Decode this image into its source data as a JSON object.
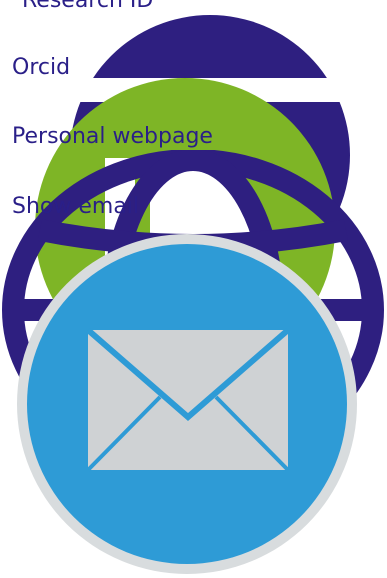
{
  "profile_links": {
    "research_id": "Research ID",
    "orcid": "Orcid",
    "personal_webpage": "Personal webpage",
    "show_email": "Show email"
  },
  "icons": [
    "researcher-id-icon",
    "orcid-icon",
    "globe-icon",
    "email-envelope-icon"
  ],
  "colors": {
    "link_text": "#2a1f88",
    "dark_purple": "#2e1f80",
    "orcid_green": "#7eb526",
    "email_blue": "#2e9bd6",
    "envelope_grey": "#cfd2d4"
  }
}
